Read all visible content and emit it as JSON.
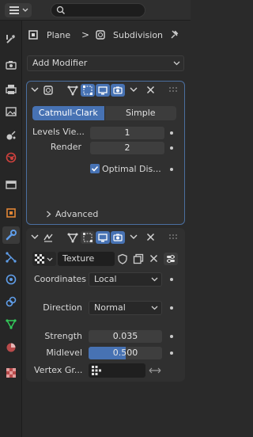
{
  "header": {
    "search": {
      "value": "",
      "placeholder": ""
    }
  },
  "breadcrumb": {
    "object": "Plane",
    "separator": ">",
    "modifier": "Subdivision"
  },
  "add_modifier": {
    "label": "Add Modifier"
  },
  "subdivision_panel": {
    "mode_tabs": [
      {
        "label": "Catmull-Clark",
        "active": true
      },
      {
        "label": "Simple",
        "active": false
      }
    ],
    "rows": [
      {
        "label": "Levels Vie...",
        "value": "1"
      },
      {
        "label": "Render",
        "value": "2"
      }
    ],
    "optimal_display": {
      "label": "Optimal Dis...",
      "checked": true
    },
    "advanced": {
      "label": "Advanced"
    }
  },
  "displace_panel": {
    "texture": {
      "name": "Texture"
    },
    "coordinates": {
      "label": "Coordinates",
      "value": "Local"
    },
    "direction": {
      "label": "Direction",
      "value": "Normal"
    },
    "strength": {
      "label": "Strength",
      "value": "0.035"
    },
    "midlevel": {
      "label": "Midlevel",
      "value": "0.500",
      "fill_fraction": 0.5
    },
    "vertex_group": {
      "label": "Vertex Gr...",
      "value": ""
    }
  },
  "colors": {
    "accent": "#4772b3",
    "panel_border_active": "#4b6fa0",
    "bg": "#2a2a2a"
  }
}
